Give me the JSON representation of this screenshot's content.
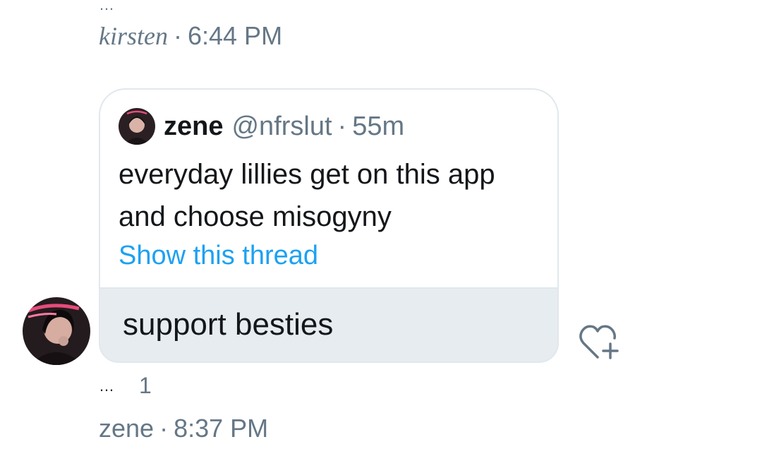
{
  "previous_message": {
    "author": "kirsten",
    "time": "6:44 PM"
  },
  "quoted_tweet": {
    "name": "zene",
    "handle": "@nfrslut",
    "age": "55m",
    "text": "everyday lillies get on this app and choose misogyny",
    "show_thread": "Show this thread"
  },
  "message": {
    "text": "support besties",
    "reaction_count": "1",
    "author": "zene",
    "time": "8:37 PM"
  },
  "separator": "·",
  "icons": {
    "more": "more-horizontal-icon",
    "react": "heart-add-icon"
  },
  "colors": {
    "link": "#1da1f2",
    "muted": "#657786",
    "bubble": "#e6ecf0",
    "border": "#e1e8ed"
  }
}
